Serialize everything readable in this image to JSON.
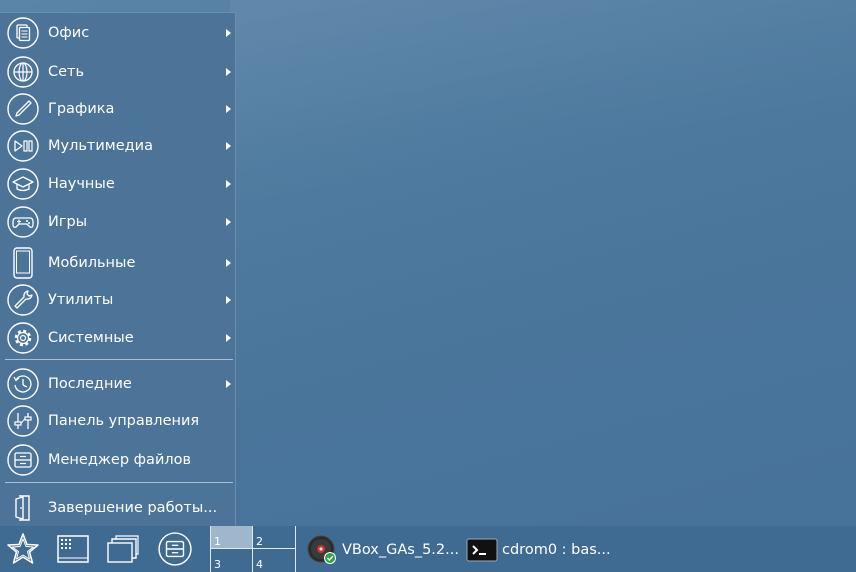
{
  "menu": {
    "items": [
      {
        "label": "Офис",
        "icon": "office-icon",
        "submenu": true
      },
      {
        "label": "Сеть",
        "icon": "network-globe-icon",
        "submenu": true
      },
      {
        "label": "Графика",
        "icon": "graphics-brush-icon",
        "submenu": true
      },
      {
        "label": "Мультимедиа",
        "icon": "multimedia-play-pause-icon",
        "submenu": true
      },
      {
        "label": "Научные",
        "icon": "education-cap-icon",
        "submenu": true
      },
      {
        "label": "Игры",
        "icon": "gamepad-icon",
        "submenu": true
      },
      {
        "label": "Мобильные",
        "icon": "mobile-phone-icon",
        "submenu": true
      },
      {
        "label": "Утилиты",
        "icon": "utilities-wrench-icon",
        "submenu": true
      },
      {
        "label": "Системные",
        "icon": "system-gear-icon",
        "submenu": true
      },
      {
        "label": "Последние",
        "icon": "recent-clock-icon",
        "submenu": true
      },
      {
        "label": "Панель управления",
        "icon": "control-panel-sliders-icon",
        "submenu": false
      },
      {
        "label": "Менеджер файлов",
        "icon": "file-manager-cabinet-icon",
        "submenu": false
      },
      {
        "label": "Завершение работы...",
        "icon": "logout-door-icon",
        "submenu": false
      }
    ]
  },
  "taskbar": {
    "start_icon": "star-start-icon",
    "launchers": [
      "app-grid-icon",
      "windows-stack-icon",
      "file-manager-cabinet-icon"
    ],
    "pager": [
      "1",
      "2",
      "3",
      "4"
    ],
    "active_desktop": "1",
    "tasks": [
      {
        "label": "VBox_GAs_5.2...",
        "icon": "cdrom-disc-icon"
      },
      {
        "label": "cdrom0 : bas...",
        "icon": "terminal-icon"
      }
    ]
  },
  "colors": {
    "desktop": "#4f7ba0",
    "menu_bg": "#4c7499",
    "taskbar_bg": "#3f6b93",
    "text": "#ffffff"
  }
}
